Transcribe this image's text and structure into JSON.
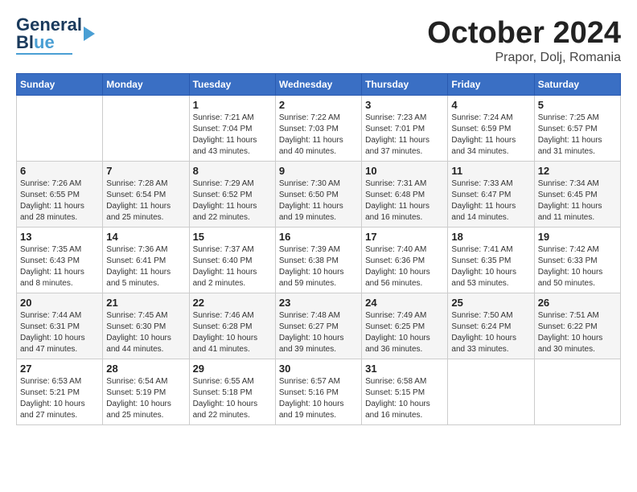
{
  "header": {
    "logo_line1": "General",
    "logo_line2": "Blue",
    "month_title": "October 2024",
    "location": "Prapor, Dolj, Romania"
  },
  "weekdays": [
    "Sunday",
    "Monday",
    "Tuesday",
    "Wednesday",
    "Thursday",
    "Friday",
    "Saturday"
  ],
  "weeks": [
    [
      {
        "day": "",
        "sunrise": "",
        "sunset": "",
        "daylight": ""
      },
      {
        "day": "",
        "sunrise": "",
        "sunset": "",
        "daylight": ""
      },
      {
        "day": "1",
        "sunrise": "Sunrise: 7:21 AM",
        "sunset": "Sunset: 7:04 PM",
        "daylight": "Daylight: 11 hours and 43 minutes."
      },
      {
        "day": "2",
        "sunrise": "Sunrise: 7:22 AM",
        "sunset": "Sunset: 7:03 PM",
        "daylight": "Daylight: 11 hours and 40 minutes."
      },
      {
        "day": "3",
        "sunrise": "Sunrise: 7:23 AM",
        "sunset": "Sunset: 7:01 PM",
        "daylight": "Daylight: 11 hours and 37 minutes."
      },
      {
        "day": "4",
        "sunrise": "Sunrise: 7:24 AM",
        "sunset": "Sunset: 6:59 PM",
        "daylight": "Daylight: 11 hours and 34 minutes."
      },
      {
        "day": "5",
        "sunrise": "Sunrise: 7:25 AM",
        "sunset": "Sunset: 6:57 PM",
        "daylight": "Daylight: 11 hours and 31 minutes."
      }
    ],
    [
      {
        "day": "6",
        "sunrise": "Sunrise: 7:26 AM",
        "sunset": "Sunset: 6:55 PM",
        "daylight": "Daylight: 11 hours and 28 minutes."
      },
      {
        "day": "7",
        "sunrise": "Sunrise: 7:28 AM",
        "sunset": "Sunset: 6:54 PM",
        "daylight": "Daylight: 11 hours and 25 minutes."
      },
      {
        "day": "8",
        "sunrise": "Sunrise: 7:29 AM",
        "sunset": "Sunset: 6:52 PM",
        "daylight": "Daylight: 11 hours and 22 minutes."
      },
      {
        "day": "9",
        "sunrise": "Sunrise: 7:30 AM",
        "sunset": "Sunset: 6:50 PM",
        "daylight": "Daylight: 11 hours and 19 minutes."
      },
      {
        "day": "10",
        "sunrise": "Sunrise: 7:31 AM",
        "sunset": "Sunset: 6:48 PM",
        "daylight": "Daylight: 11 hours and 16 minutes."
      },
      {
        "day": "11",
        "sunrise": "Sunrise: 7:33 AM",
        "sunset": "Sunset: 6:47 PM",
        "daylight": "Daylight: 11 hours and 14 minutes."
      },
      {
        "day": "12",
        "sunrise": "Sunrise: 7:34 AM",
        "sunset": "Sunset: 6:45 PM",
        "daylight": "Daylight: 11 hours and 11 minutes."
      }
    ],
    [
      {
        "day": "13",
        "sunrise": "Sunrise: 7:35 AM",
        "sunset": "Sunset: 6:43 PM",
        "daylight": "Daylight: 11 hours and 8 minutes."
      },
      {
        "day": "14",
        "sunrise": "Sunrise: 7:36 AM",
        "sunset": "Sunset: 6:41 PM",
        "daylight": "Daylight: 11 hours and 5 minutes."
      },
      {
        "day": "15",
        "sunrise": "Sunrise: 7:37 AM",
        "sunset": "Sunset: 6:40 PM",
        "daylight": "Daylight: 11 hours and 2 minutes."
      },
      {
        "day": "16",
        "sunrise": "Sunrise: 7:39 AM",
        "sunset": "Sunset: 6:38 PM",
        "daylight": "Daylight: 10 hours and 59 minutes."
      },
      {
        "day": "17",
        "sunrise": "Sunrise: 7:40 AM",
        "sunset": "Sunset: 6:36 PM",
        "daylight": "Daylight: 10 hours and 56 minutes."
      },
      {
        "day": "18",
        "sunrise": "Sunrise: 7:41 AM",
        "sunset": "Sunset: 6:35 PM",
        "daylight": "Daylight: 10 hours and 53 minutes."
      },
      {
        "day": "19",
        "sunrise": "Sunrise: 7:42 AM",
        "sunset": "Sunset: 6:33 PM",
        "daylight": "Daylight: 10 hours and 50 minutes."
      }
    ],
    [
      {
        "day": "20",
        "sunrise": "Sunrise: 7:44 AM",
        "sunset": "Sunset: 6:31 PM",
        "daylight": "Daylight: 10 hours and 47 minutes."
      },
      {
        "day": "21",
        "sunrise": "Sunrise: 7:45 AM",
        "sunset": "Sunset: 6:30 PM",
        "daylight": "Daylight: 10 hours and 44 minutes."
      },
      {
        "day": "22",
        "sunrise": "Sunrise: 7:46 AM",
        "sunset": "Sunset: 6:28 PM",
        "daylight": "Daylight: 10 hours and 41 minutes."
      },
      {
        "day": "23",
        "sunrise": "Sunrise: 7:48 AM",
        "sunset": "Sunset: 6:27 PM",
        "daylight": "Daylight: 10 hours and 39 minutes."
      },
      {
        "day": "24",
        "sunrise": "Sunrise: 7:49 AM",
        "sunset": "Sunset: 6:25 PM",
        "daylight": "Daylight: 10 hours and 36 minutes."
      },
      {
        "day": "25",
        "sunrise": "Sunrise: 7:50 AM",
        "sunset": "Sunset: 6:24 PM",
        "daylight": "Daylight: 10 hours and 33 minutes."
      },
      {
        "day": "26",
        "sunrise": "Sunrise: 7:51 AM",
        "sunset": "Sunset: 6:22 PM",
        "daylight": "Daylight: 10 hours and 30 minutes."
      }
    ],
    [
      {
        "day": "27",
        "sunrise": "Sunrise: 6:53 AM",
        "sunset": "Sunset: 5:21 PM",
        "daylight": "Daylight: 10 hours and 27 minutes."
      },
      {
        "day": "28",
        "sunrise": "Sunrise: 6:54 AM",
        "sunset": "Sunset: 5:19 PM",
        "daylight": "Daylight: 10 hours and 25 minutes."
      },
      {
        "day": "29",
        "sunrise": "Sunrise: 6:55 AM",
        "sunset": "Sunset: 5:18 PM",
        "daylight": "Daylight: 10 hours and 22 minutes."
      },
      {
        "day": "30",
        "sunrise": "Sunrise: 6:57 AM",
        "sunset": "Sunset: 5:16 PM",
        "daylight": "Daylight: 10 hours and 19 minutes."
      },
      {
        "day": "31",
        "sunrise": "Sunrise: 6:58 AM",
        "sunset": "Sunset: 5:15 PM",
        "daylight": "Daylight: 10 hours and 16 minutes."
      },
      {
        "day": "",
        "sunrise": "",
        "sunset": "",
        "daylight": ""
      },
      {
        "day": "",
        "sunrise": "",
        "sunset": "",
        "daylight": ""
      }
    ]
  ]
}
